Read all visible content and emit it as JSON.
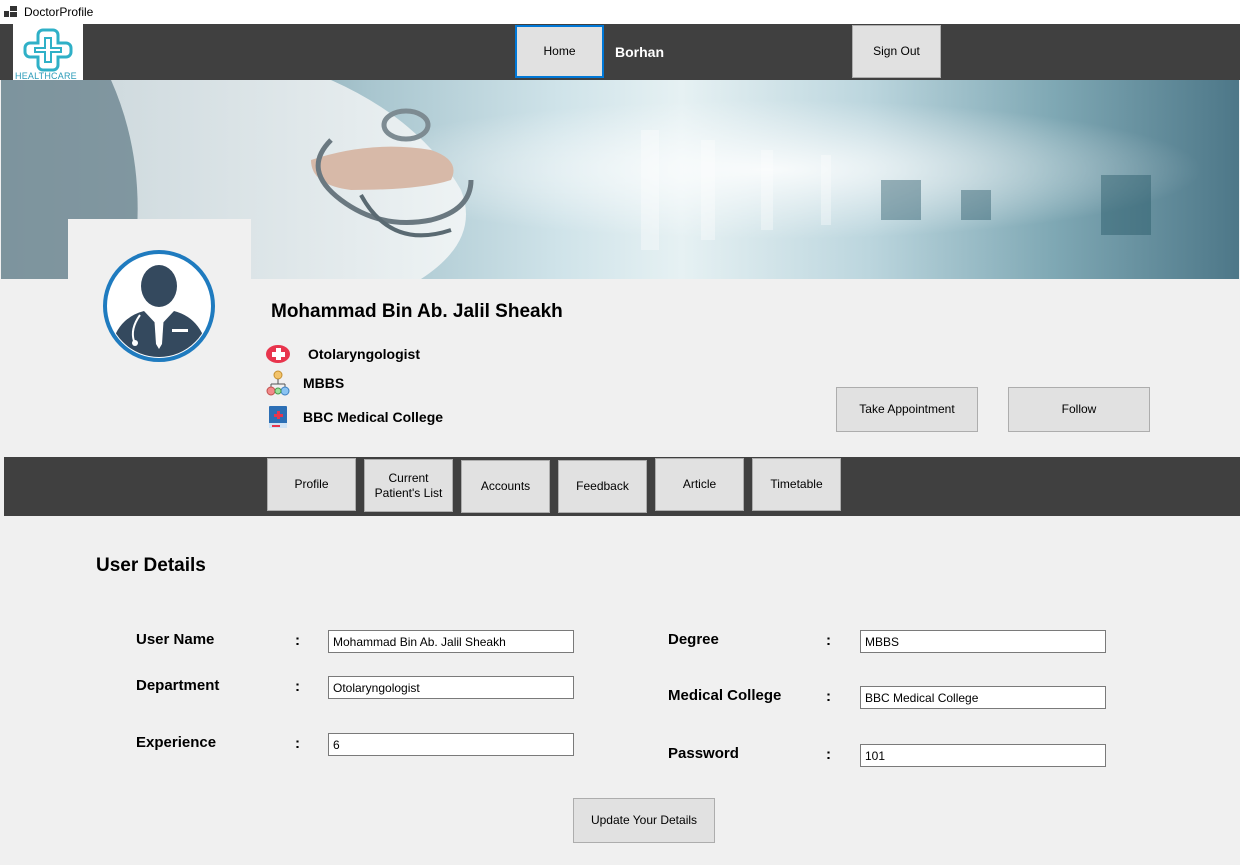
{
  "window": {
    "title": "DoctorProfile"
  },
  "logo": {
    "text": "HEALTHCARE"
  },
  "topnav": {
    "home_label": "Home",
    "username": "Borhan",
    "signout_label": "Sign Out"
  },
  "doctor": {
    "name": "Mohammad Bin Ab. Jalil Sheakh",
    "department": "Otolaryngologist",
    "degree": "MBBS",
    "college": "BBC Medical College"
  },
  "actions": {
    "appointment_label": "Take Appointment",
    "follow_label": "Follow"
  },
  "tabs": {
    "profile": "Profile",
    "patients_line1": "Current",
    "patients_line2": "Patient's List",
    "accounts": "Accounts",
    "feedback": "Feedback",
    "article": "Article",
    "timetable": "Timetable"
  },
  "details": {
    "title": "User Details",
    "colon": ":",
    "username_label": "User Name",
    "username_value": "Mohammad Bin Ab. Jalil Sheakh",
    "department_label": "Department",
    "department_value": "Otolaryngologist",
    "experience_label": "Experience",
    "experience_value": "6",
    "degree_label": "Degree",
    "degree_value": "MBBS",
    "college_label": "Medical College",
    "college_value": "BBC Medical College",
    "password_label": "Password",
    "password_value": "101",
    "update_label": "Update Your Details"
  },
  "colors": {
    "nav_bg": "#404040",
    "accent": "#0078d7",
    "avatar_ring": "#1f7bbf",
    "avatar_fill": "#34495e"
  },
  "icons": {
    "window": "window-icon",
    "logo": "medical-cross-icon",
    "department": "red-cross-icon",
    "degree": "people-network-icon",
    "college": "medical-book-icon",
    "avatar": "doctor-avatar-icon"
  }
}
